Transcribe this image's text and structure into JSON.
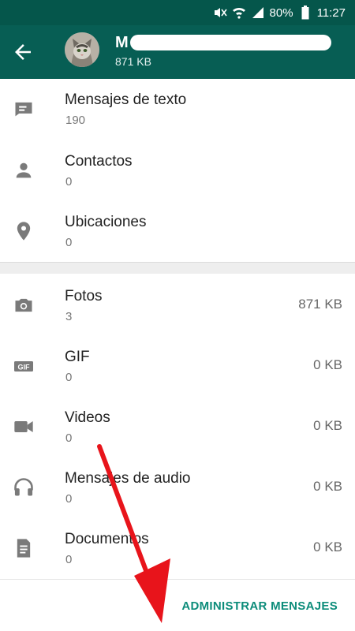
{
  "status_bar": {
    "battery": "80%",
    "time": "11:27"
  },
  "header": {
    "title": "M",
    "subtitle": "871 KB",
    "back_icon": "arrow-left-icon"
  },
  "section1": [
    {
      "label": "Mensajes de texto",
      "count": "190",
      "icon": "message-icon"
    },
    {
      "label": "Contactos",
      "count": "0",
      "icon": "person-icon"
    },
    {
      "label": "Ubicaciones",
      "count": "0",
      "icon": "location-pin-icon"
    }
  ],
  "section2": [
    {
      "label": "Fotos",
      "count": "3",
      "size": "871 KB",
      "icon": "camera-icon"
    },
    {
      "label": "GIF",
      "count": "0",
      "size": "0 KB",
      "icon": "gif-icon"
    },
    {
      "label": "Videos",
      "count": "0",
      "size": "0 KB",
      "icon": "video-icon"
    },
    {
      "label": "Mensajes de audio",
      "count": "0",
      "size": "0 KB",
      "icon": "headphones-icon"
    },
    {
      "label": "Documentos",
      "count": "0",
      "size": "0 KB",
      "icon": "document-icon"
    }
  ],
  "footer": {
    "manage_label": "ADMINISTRAR MENSAJES"
  },
  "colors": {
    "header": "#075e54",
    "status_bar": "#05564b",
    "accent": "#0c8c7a",
    "arrow": "#e8141b"
  }
}
